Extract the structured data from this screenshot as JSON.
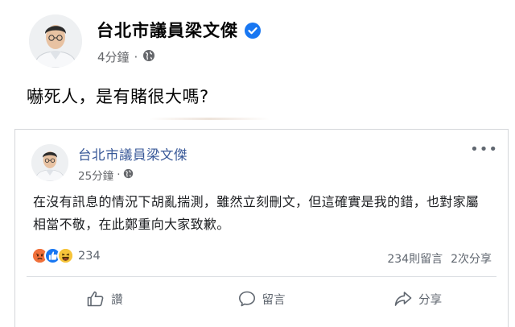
{
  "outer_post": {
    "author": "台北市議員梁文傑",
    "time": "4分鐘",
    "separator": "·",
    "text": "嚇死人，是有賭很大嗎?"
  },
  "shared_post": {
    "author": "台北市議員梁文傑",
    "time": "25分鐘",
    "separator": "·",
    "more": "•••",
    "text": "在沒有訊息的情況下胡亂揣測，雖然立刻刪文，但這確實是我的錯，也對家屬相當不敬，在此鄭重向大家致歉。",
    "reactions": [
      "angry",
      "like",
      "haha"
    ],
    "reaction_count": "234",
    "comment_count": "234則留言",
    "share_count": "2次分享"
  },
  "actions": {
    "like": "讚",
    "comment": "留言",
    "share": "分享"
  },
  "colors": {
    "verified": "#1877f2",
    "link_name": "#385898",
    "angry": "#f0703a",
    "like": "#1877f2",
    "haha": "#f7c43a"
  }
}
